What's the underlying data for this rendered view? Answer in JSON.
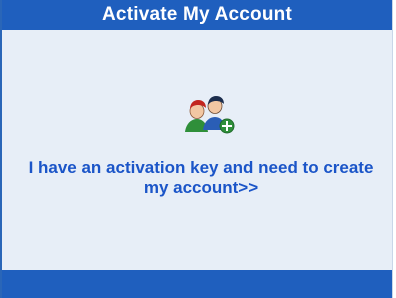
{
  "panel": {
    "title": "Activate My Account",
    "link_label": "I have an activation key and need to create my account>>",
    "icon": "users-add-icon"
  },
  "colors": {
    "header_bg": "#1f5fbe",
    "panel_bg": "#e7eef7",
    "link_text": "#1b55c8",
    "footer_bg": "#1f5fbe"
  }
}
